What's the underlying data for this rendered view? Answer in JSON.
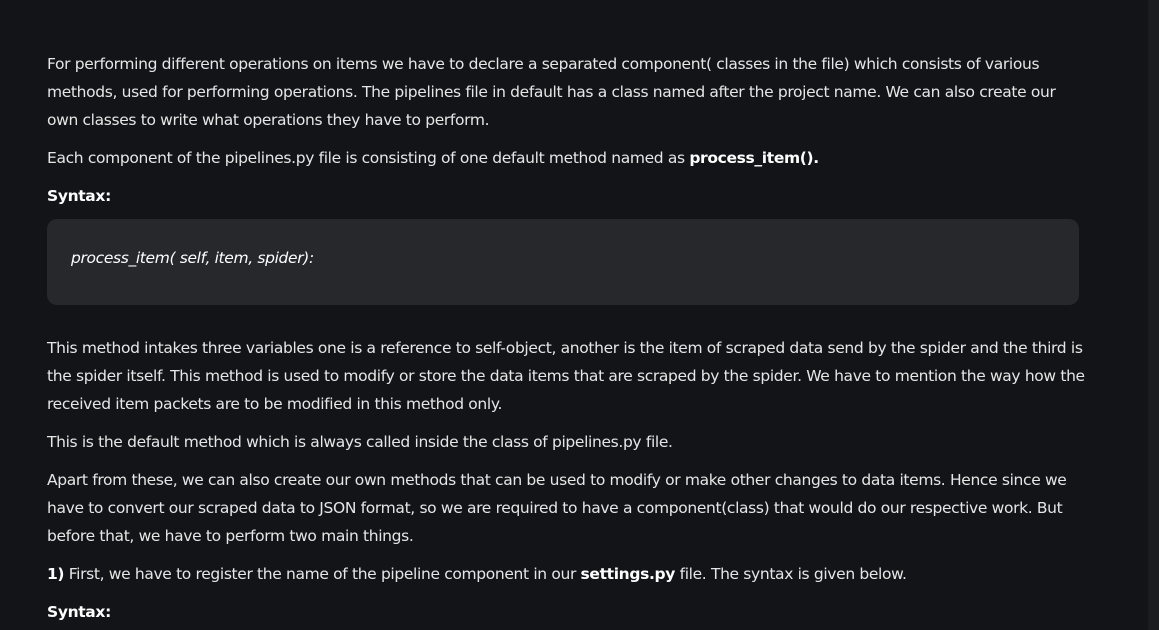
{
  "article": {
    "para1": "For performing different operations on items we have to declare a separated component( classes in the file) which consists of various methods, used for performing operations. The pipelines file in default has a class named after the project name. We can also create our own classes to write what operations they have to perform.",
    "para2_text": "Each component of the pipelines.py file is consisting of one default method named as ",
    "para2_bold": "process_item().",
    "syntax_label_1": "Syntax:",
    "code_1": "process_item( self, item, spider):",
    "para3": "This method intakes three variables one is a reference to self-object, another is the item of scraped data send by the spider and the third is the spider itself. This method is used to modify or store the data items that are scraped by the spider. We have to mention the way how the received item packets are to be modified in this method only.",
    "para4": "This is the default method which is always called inside the class of pipelines.py file.",
    "para5": "Apart from these, we can also create our own methods that can be used to modify or make other changes to data items. Hence since we have to convert our scraped data to JSON format, so we are required to have a component(class) that would do our respective work. But before that, we have to perform two main things.",
    "para6_num": "1)",
    "para6_text": " First, we have to register the name of the pipeline component in our ",
    "para6_bold": "settings.py",
    "para6_tail": " file. The syntax is given below.",
    "syntax_label_2": "Syntax:"
  }
}
